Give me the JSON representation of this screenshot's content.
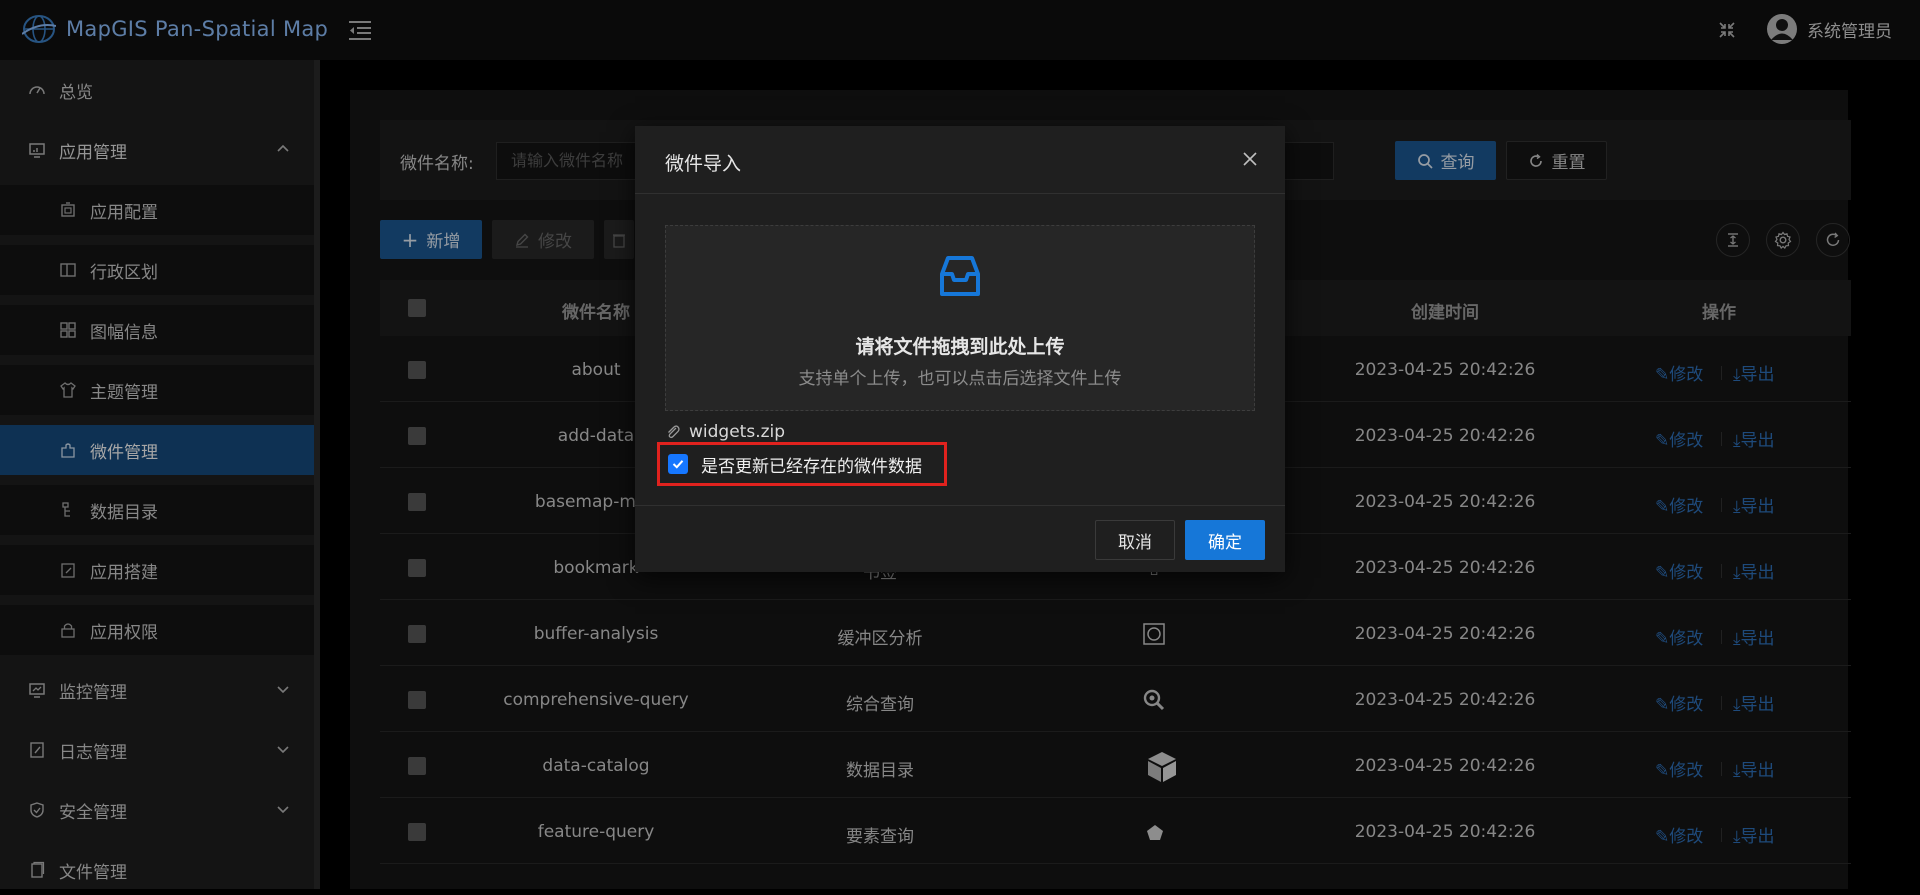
{
  "app": {
    "title": "MapGIS Pan-Spatial Map",
    "user": "系统管理员"
  },
  "sidebar": {
    "items": [
      {
        "label": "总览",
        "icon": "dashboard-icon",
        "level": "top"
      },
      {
        "label": "应用管理",
        "icon": "app-monitor-icon",
        "level": "top",
        "expanded": true
      },
      {
        "label": "应用配置",
        "icon": "app-config-icon",
        "level": "sub"
      },
      {
        "label": "行政区划",
        "icon": "region-icon",
        "level": "sub"
      },
      {
        "label": "图幅信息",
        "icon": "grid-icon",
        "level": "sub"
      },
      {
        "label": "主题管理",
        "icon": "theme-icon",
        "level": "sub"
      },
      {
        "label": "微件管理",
        "icon": "widget-icon",
        "level": "sub",
        "active": true
      },
      {
        "label": "数据目录",
        "icon": "catalog-icon",
        "level": "sub"
      },
      {
        "label": "应用搭建",
        "icon": "build-icon",
        "level": "sub"
      },
      {
        "label": "应用权限",
        "icon": "lock-icon",
        "level": "sub"
      },
      {
        "label": "监控管理",
        "icon": "monitor-icon",
        "level": "top",
        "expanded": false
      },
      {
        "label": "日志管理",
        "icon": "log-icon",
        "level": "top",
        "expanded": false
      },
      {
        "label": "安全管理",
        "icon": "shield-icon",
        "level": "top",
        "expanded": false
      },
      {
        "label": "文件管理",
        "icon": "file-icon",
        "level": "top"
      }
    ]
  },
  "search": {
    "label": "微件名称:",
    "placeholder": "请输入微件名称",
    "query_label": "查询",
    "reset_label": "重置"
  },
  "toolbar": {
    "add_label": "新增",
    "edit_label": "修改"
  },
  "table": {
    "headers": [
      "微件名称",
      "创建时间",
      "操作"
    ],
    "rows": [
      {
        "name": "about",
        "label": "",
        "icon": "",
        "created": "2023-04-25 20:42:26"
      },
      {
        "name": "add-data",
        "label": "",
        "icon": "",
        "created": "2023-04-25 20:42:26"
      },
      {
        "name": "basemap-man",
        "label": "",
        "icon": "",
        "created": "2023-04-25 20:42:26"
      },
      {
        "name": "bookmark",
        "label": "书签",
        "icon": "bookmark-icon",
        "created": "2023-04-25 20:42:26"
      },
      {
        "name": "buffer-analysis",
        "label": "缓冲区分析",
        "icon": "buffer-icon",
        "created": "2023-04-25 20:42:26"
      },
      {
        "name": "comprehensive-query",
        "label": "综合查询",
        "icon": "search-zoom-icon",
        "created": "2023-04-25 20:42:26"
      },
      {
        "name": "data-catalog",
        "label": "数据目录",
        "icon": "cube-icon",
        "created": "2023-04-25 20:42:26"
      },
      {
        "name": "feature-query",
        "label": "要素查询",
        "icon": "pentagon-icon",
        "created": "2023-04-25 20:42:26"
      }
    ],
    "op_edit": "修改",
    "op_export": "导出"
  },
  "modal": {
    "title": "微件导入",
    "drop_title": "请将文件拖拽到此处上传",
    "drop_sub": "支持单个上传，也可以点击后选择文件上传",
    "file_name": "widgets.zip",
    "update_label": "是否更新已经存在的微件数据",
    "update_checked": true,
    "cancel_label": "取消",
    "ok_label": "确定"
  },
  "colors": {
    "accent": "#1677d8",
    "highlight": "#e0221e",
    "active_nav": "#164c80"
  }
}
